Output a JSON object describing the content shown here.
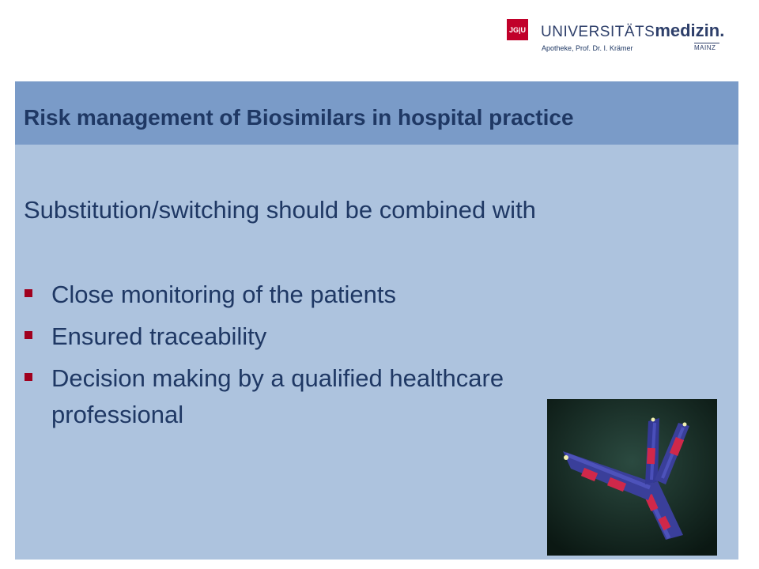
{
  "header": {
    "logo_mark": "JG|U",
    "logo_word_light": "UNIVERSITÄTS",
    "logo_word_bold": "medizin.",
    "logo_city": "MAINZ",
    "subtitle": "Apotheke, Prof. Dr. I. Krämer"
  },
  "slide": {
    "title": "Risk management of Biosimilars in hospital practice",
    "lead": "Substitution/switching should be combined with",
    "bullets": [
      "Close monitoring of the patients",
      "Ensured traceability",
      "Decision making by a qualified healthcare",
      "professional"
    ]
  },
  "colors": {
    "title_band": "#7a9bc8",
    "body_panel": "#adc3de",
    "text": "#1f3864",
    "bullet": "#a0001e",
    "logo_red": "#c1002a"
  },
  "figure": {
    "icon": "antibody-image"
  }
}
